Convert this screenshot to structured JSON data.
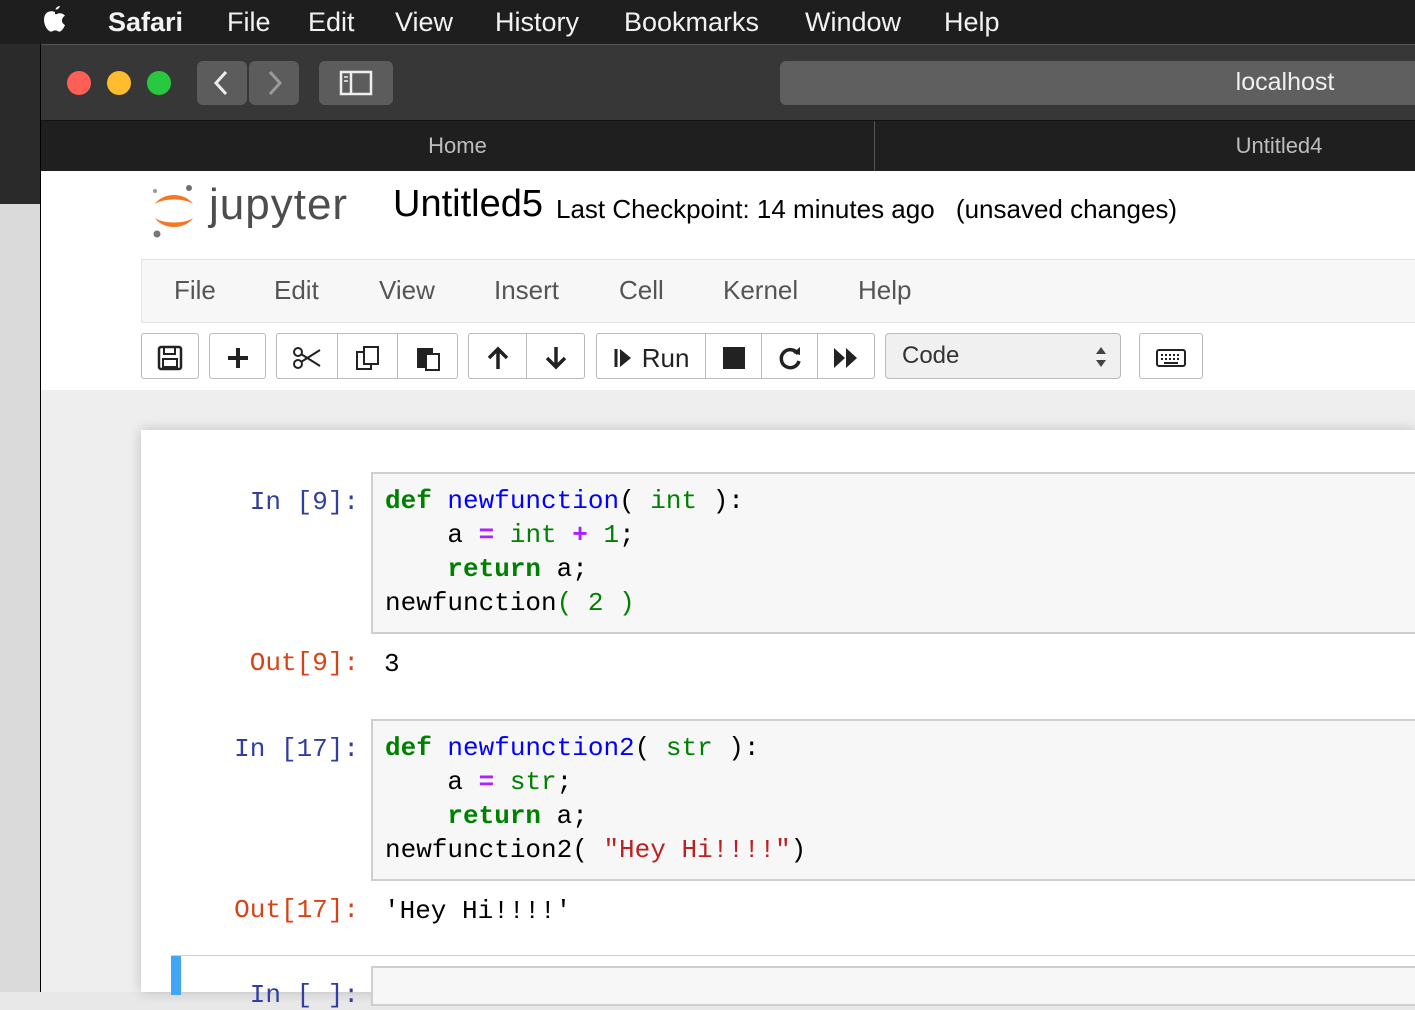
{
  "mac_menu": {
    "apple": "",
    "app": "Safari",
    "items": [
      "File",
      "Edit",
      "View",
      "History",
      "Bookmarks",
      "Window",
      "Help"
    ]
  },
  "browser": {
    "address": "localhost",
    "tabs": [
      {
        "label": "Home",
        "active": false
      },
      {
        "label": "Untitled4",
        "active": false
      }
    ]
  },
  "jupyter": {
    "logo_text": "jupyter",
    "notebook_name": "Untitled5",
    "checkpoint": "Last Checkpoint: 14 minutes ago",
    "status": "(unsaved changes)",
    "menu": [
      "File",
      "Edit",
      "View",
      "Insert",
      "Cell",
      "Kernel",
      "Help"
    ],
    "toolbar": {
      "run_label": "Run",
      "cell_type": "Code",
      "cell_type_options": [
        "Code"
      ]
    }
  },
  "cells": [
    {
      "in_prompt": "In [9]:",
      "code_lines": [
        "def newfunction( int ):",
        "    a = int + 1;",
        "    return a;",
        "newfunction( 2 )"
      ],
      "out_prompt": "Out[9]:",
      "output": "3"
    },
    {
      "in_prompt": "In [17]:",
      "code_lines": [
        "def newfunction2( str ):",
        "    a = str;",
        "    return a;",
        "newfunction2( \"Hey Hi!!!!\")"
      ],
      "out_prompt": "Out[17]:",
      "output": "'Hey Hi!!!!'"
    },
    {
      "in_prompt": "In [ ]:"
    }
  ],
  "colors": {
    "in_prompt": "#303f9f",
    "out_prompt": "#d84315",
    "selected_cell_bar": "#42a5f5",
    "jupyter_orange": "#f37726"
  }
}
